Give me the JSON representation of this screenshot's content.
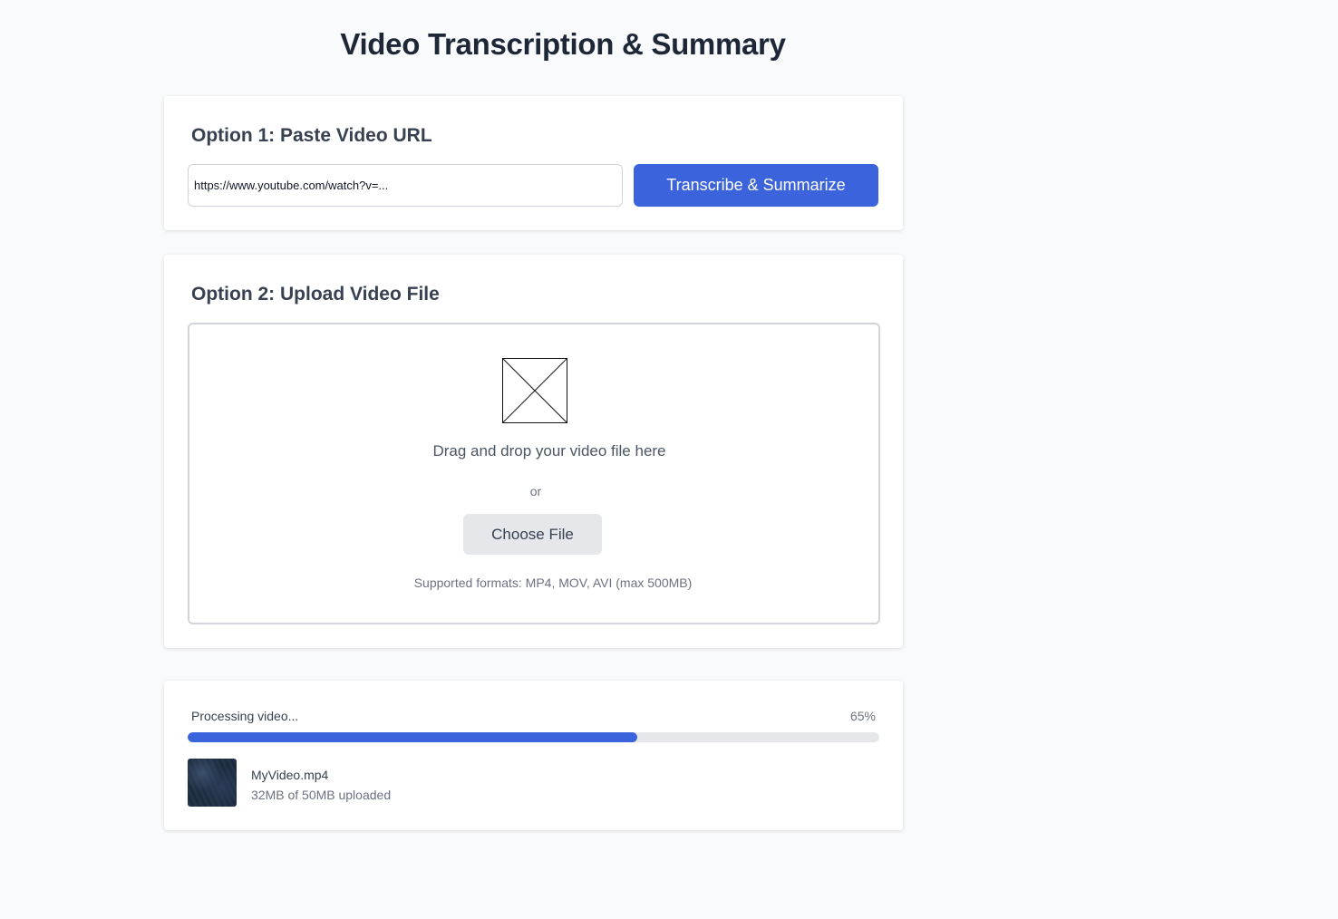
{
  "page": {
    "title": "Video Transcription & Summary"
  },
  "url_option": {
    "heading": "Option 1: Paste Video URL",
    "input_value": "https://www.youtube.com/watch?v=...",
    "input_placeholder": "",
    "submit_label": "Transcribe & Summarize"
  },
  "upload_option": {
    "heading": "Option 2: Upload Video File",
    "upload_icon": "broken-image-placeholder-icon",
    "drop_text": "Drag and drop your video file here",
    "or_text": "or",
    "choose_label": "Choose File",
    "formats_text": "Supported formats: MP4, MOV, AVI (max 500MB)"
  },
  "progress": {
    "label": "Processing video...",
    "percent_text": "65%",
    "percent_value": 65,
    "file_name": "MyVideo.mp4",
    "file_status": "32MB of 50MB uploaded"
  },
  "colors": {
    "accent": "#3b63db",
    "background": "#f9fafb",
    "track": "#e5e7eb"
  }
}
